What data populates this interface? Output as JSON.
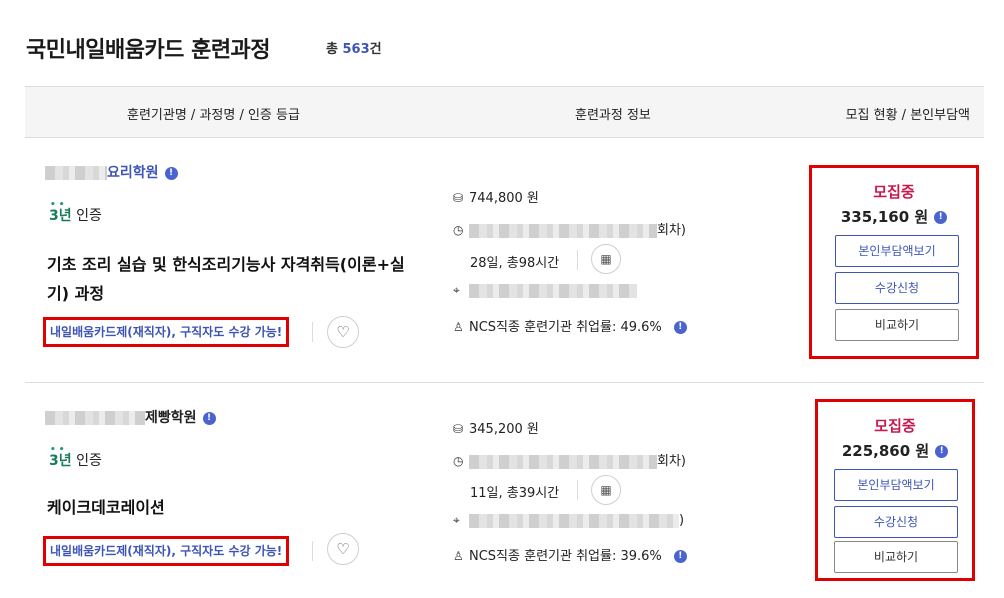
{
  "header": {
    "title": "국민내일배움카드 훈련과정",
    "total_prefix": "총",
    "total_count": "563",
    "total_suffix": "건"
  },
  "table_headers": {
    "col1": "훈련기관명 / 과정명 / 인증 등급",
    "col2": "훈련과정 정보",
    "col3": "모집 현황 / 본인부담액"
  },
  "rows": [
    {
      "institution": "요리학원",
      "cert_year": "3년",
      "cert_label": "인증",
      "course": "기초 조리 실습 및 한식조리기능사 자격취득(이론+실기) 과정",
      "tag": "내일배움카드제(재직자), 구직자도 수강 가능!",
      "fee": "744,800 원",
      "session_suffix": "회차)",
      "duration": "28일, 총98시간",
      "employment": "NCS직종 훈련기관 취업률: 49.6%",
      "status": "모집중",
      "self_pay": "335,160 원",
      "btn_self": "본인부담액보기",
      "btn_apply": "수강신청",
      "btn_compare": "비교하기"
    },
    {
      "institution": "제빵학원",
      "cert_year": "3년",
      "cert_label": "인증",
      "course": "케이크데코레이션",
      "tag": "내일배움카드제(재직자), 구직자도 수강 가능!",
      "fee": "345,200 원",
      "session_suffix": "회차)",
      "duration": "11일, 총39시간",
      "address_suffix": ")",
      "employment": "NCS직종 훈련기관 취업률: 39.6%",
      "status": "모집중",
      "self_pay": "225,860 원",
      "btn_self": "본인부담액보기",
      "btn_apply": "수강신청",
      "btn_compare": "비교하기"
    }
  ]
}
